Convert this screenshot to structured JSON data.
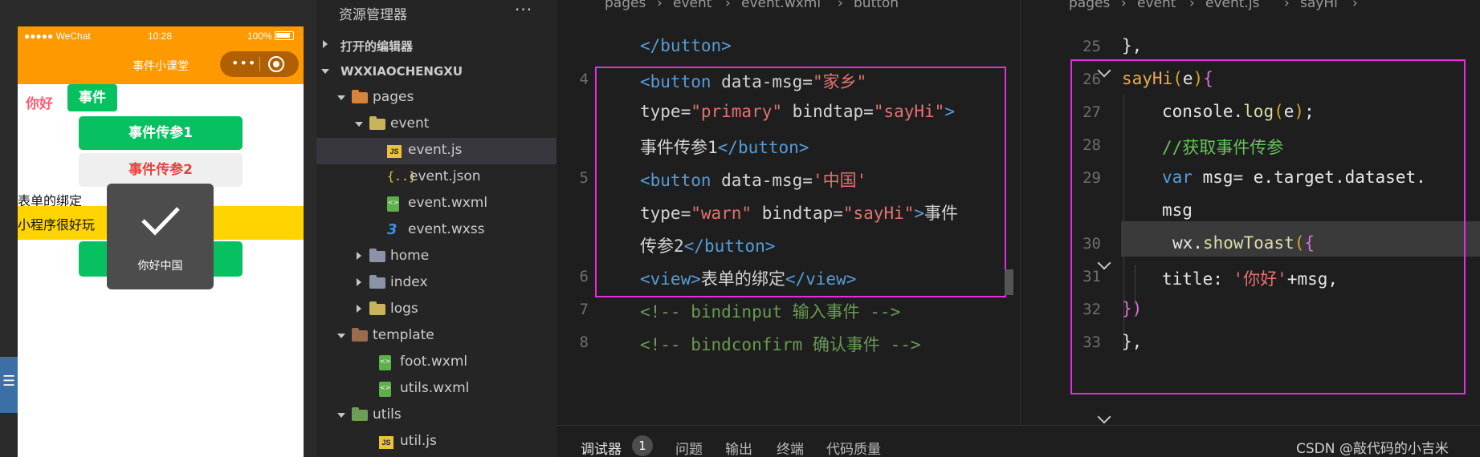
{
  "simulator": {
    "status_left": "●●●●● WeChat",
    "status_time": "10:28",
    "status_battery": "100%",
    "nav_title": "事件小课堂",
    "capsule_dots": "•••",
    "text_nihao": "你好",
    "button_event": "事件",
    "button_primary": "事件传参1",
    "button_warn": "事件传参2",
    "text_form_binding": "表单的绑定",
    "text_yellow": "小程序很好玩",
    "toast_text": "你好中国",
    "side_strip": "☰"
  },
  "explorer": {
    "title": "资源管理器",
    "more": "···",
    "rows": [
      {
        "label": "打开的编辑器",
        "arrow": "right",
        "icon": "none",
        "bold": true
      },
      {
        "label": "WXXIAOCHENGXU",
        "arrow": "down",
        "icon": "none",
        "bold": true
      },
      {
        "label": "pages",
        "arrow": "down",
        "icon": "folder-orange"
      },
      {
        "label": "event",
        "arrow": "down",
        "icon": "folder-yellow"
      },
      {
        "label": "event.js",
        "arrow": "none",
        "icon": "js",
        "selected": true
      },
      {
        "label": "event.json",
        "arrow": "none",
        "icon": "json"
      },
      {
        "label": "event.wxml",
        "arrow": "none",
        "icon": "wxml"
      },
      {
        "label": "event.wxss",
        "arrow": "none",
        "icon": "wxss"
      },
      {
        "label": "home",
        "arrow": "right",
        "icon": "folder"
      },
      {
        "label": "index",
        "arrow": "right",
        "icon": "folder"
      },
      {
        "label": "logs",
        "arrow": "right",
        "icon": "folder-yellow"
      },
      {
        "label": "template",
        "arrow": "down",
        "icon": "folder-brown"
      },
      {
        "label": "foot.wxml",
        "arrow": "none",
        "icon": "wxml"
      },
      {
        "label": "utils.wxml",
        "arrow": "none",
        "icon": "wxml"
      },
      {
        "label": "utils",
        "arrow": "down",
        "icon": "folder-green"
      },
      {
        "label": "util.js",
        "arrow": "none",
        "icon": "js"
      }
    ]
  },
  "editor_left": {
    "breadcrumb": [
      "pages",
      "›",
      "event",
      "›",
      "event.wxml",
      "›",
      "button"
    ],
    "lines": [
      {
        "num": "",
        "segments": [
          [
            "tag",
            "</button>"
          ]
        ]
      },
      {
        "num": "4",
        "segments": [
          [
            "tag",
            "<button "
          ],
          [
            "attr",
            "data-msg="
          ],
          [
            "str",
            "\"家乡\""
          ]
        ]
      },
      {
        "num": "",
        "segments": [
          [
            "attr",
            "type="
          ],
          [
            "str",
            "\"primary\""
          ],
          [
            "attr",
            " bindtap="
          ],
          [
            "str",
            "\"sayHi\""
          ],
          [
            "tag",
            ">"
          ]
        ]
      },
      {
        "num": "",
        "segments": [
          [
            "text",
            "事件传参1"
          ],
          [
            "tag",
            "</button>"
          ]
        ]
      },
      {
        "num": "5",
        "segments": [
          [
            "tag",
            "<button "
          ],
          [
            "attr",
            "data-msg="
          ],
          [
            "str",
            "'中国'"
          ]
        ]
      },
      {
        "num": "",
        "segments": [
          [
            "attr",
            "type="
          ],
          [
            "str",
            "\"warn\""
          ],
          [
            "attr",
            " bindtap="
          ],
          [
            "str",
            "\"sayHi\""
          ],
          [
            "tag",
            ">"
          ],
          [
            "text",
            "事件"
          ]
        ]
      },
      {
        "num": "",
        "segments": [
          [
            "text",
            "传参2"
          ],
          [
            "tag",
            "</button>"
          ]
        ]
      },
      {
        "num": "6",
        "segments": [
          [
            "tag",
            "<view>"
          ],
          [
            "text",
            "表单的绑定"
          ],
          [
            "tag",
            "</view>"
          ]
        ]
      },
      {
        "num": "7",
        "segments": [
          [
            "comment",
            "<!-- bindinput 输入事件 -->"
          ]
        ]
      },
      {
        "num": "8",
        "segments": [
          [
            "comment",
            "<!-- bindconfirm 确认事件 -->"
          ]
        ]
      }
    ]
  },
  "editor_right": {
    "breadcrumb": [
      "pages",
      "›",
      "event",
      "›",
      "event.js",
      "›",
      "sayHi",
      "›"
    ],
    "lines": [
      {
        "num": "25",
        "segments": [
          [
            "brace",
            "},"
          ]
        ]
      },
      {
        "num": "26",
        "segments": [
          [
            "sayhi",
            "sayHi"
          ],
          [
            "paren",
            "("
          ],
          [
            "var",
            "e"
          ],
          [
            "paren",
            ")"
          ],
          [
            "brace2",
            "{"
          ]
        ]
      },
      {
        "num": "27",
        "segments": [
          [
            "var",
            "console."
          ],
          [
            "fn",
            "log"
          ],
          [
            "paren",
            "("
          ],
          [
            "var",
            "e"
          ],
          [
            "paren",
            ")"
          ],
          [
            "var",
            ";"
          ]
        ]
      },
      {
        "num": "28",
        "segments": [
          [
            "commentg",
            "//获取事件传参"
          ]
        ]
      },
      {
        "num": "29",
        "segments": [
          [
            "kw",
            "var "
          ],
          [
            "var",
            "msg= e.target.dataset."
          ]
        ]
      },
      {
        "num": "",
        "segments": [
          [
            "var",
            "msg"
          ]
        ]
      },
      {
        "num": "30",
        "segments": [
          [
            "var",
            "wx."
          ],
          [
            "fn",
            "showToast"
          ],
          [
            "paren",
            "("
          ],
          [
            "brace2",
            "{"
          ]
        ]
      },
      {
        "num": "31",
        "segments": [
          [
            "var",
            "title: "
          ],
          [
            "str",
            "'你好'"
          ],
          [
            "var",
            "+msg,"
          ]
        ]
      },
      {
        "num": "32",
        "segments": [
          [
            "brace2",
            "})"
          ]
        ]
      },
      {
        "num": "33",
        "segments": [
          [
            "brace",
            "},"
          ]
        ]
      }
    ]
  },
  "panel": {
    "tabs": [
      "调试器",
      "问题",
      "输出",
      "终端",
      "代码质量"
    ],
    "debugger_count": "1",
    "watermark": "CSDN @敲代码的小吉米"
  },
  "colors": {
    "highlight": "#e22de2",
    "wechat_green": "#07c160",
    "nav_orange": "#ff9900",
    "warn_red": "#e64340",
    "yellow_bar": "#ffd400"
  }
}
